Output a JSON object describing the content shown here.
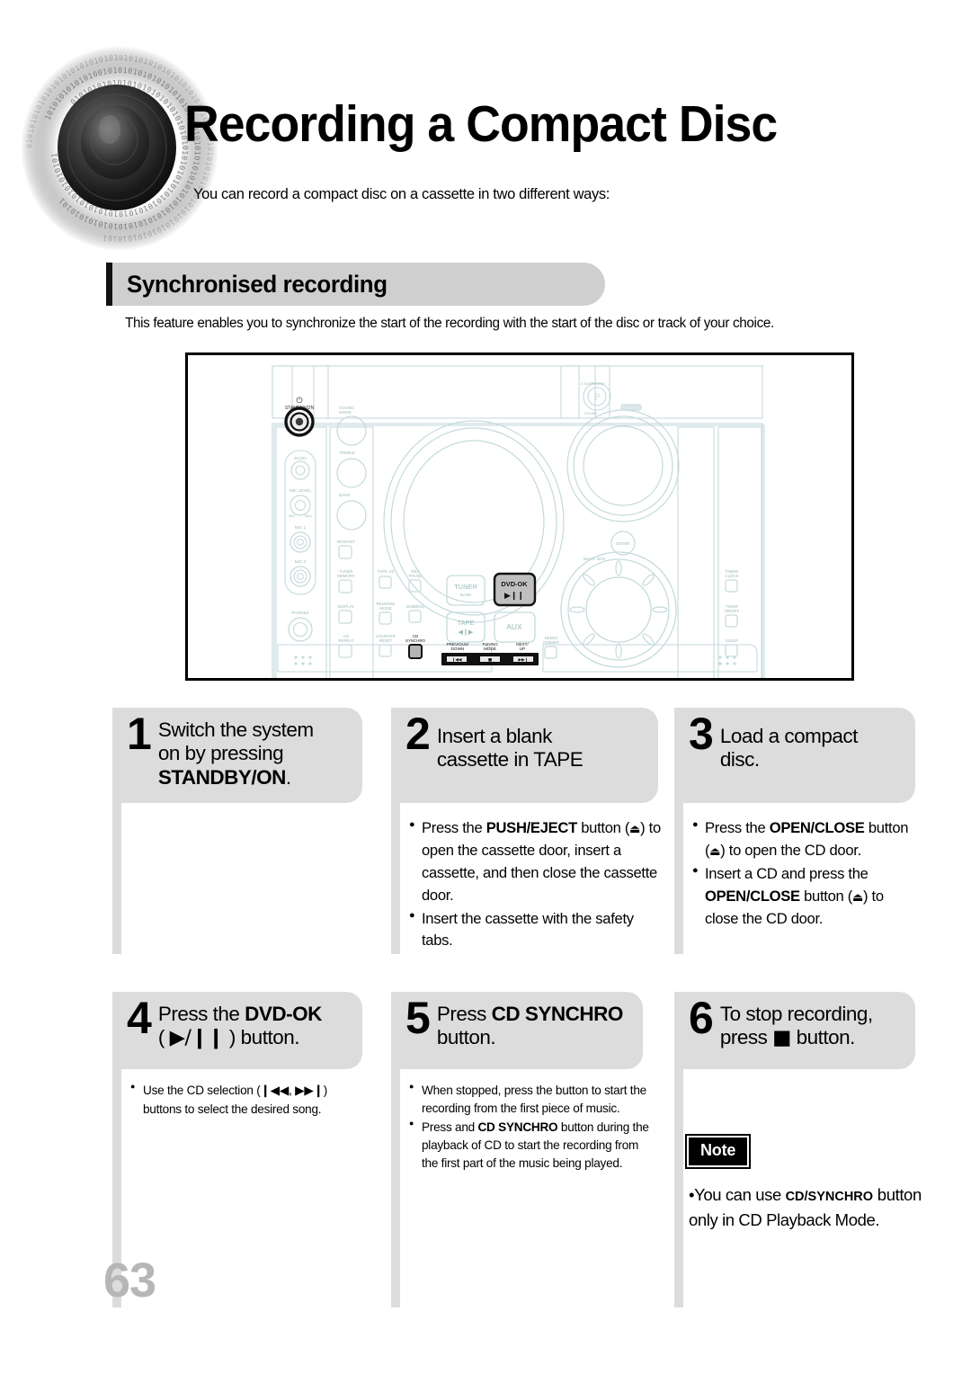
{
  "page": {
    "title": "Recording a Compact Disc",
    "intro": "You can record a compact disc on a cassette in two different ways:",
    "number": "63"
  },
  "section": {
    "heading": "Synchronised recording",
    "description": "This feature enables you to synchronize the start of the recording with the start of the disc or track of your choice."
  },
  "figure": {
    "caption": "",
    "panel_labels": {
      "standby": "STANDBY/ON",
      "sound_mode": "SOUND MODE",
      "treble": "TREBLE",
      "bass": "BASS",
      "echo": "ECHO",
      "mic_level": "MIC LEVEL",
      "mic1": "MIC 1",
      "mic2": "MIC 2",
      "phones": "PHONES",
      "mo_host": "MO/HOST",
      "tuner_memory": "TUNER MEMORY",
      "display": "DISPLAY",
      "cd_repeat": "CD REPEAT",
      "tape_12": "TAPE 1/2",
      "reverse_mode": "REVERSE MODE",
      "counter_reset": "COUNTER RESET",
      "rec_pause": "REC/PAUSE",
      "dubbing": "DUBBING",
      "cd_synchro": "CD SYNCHRO",
      "tuner_band": "TUNER/BAND",
      "dvd_ok": "DVD-OK",
      "tape": "TAPE",
      "aux": "AUX",
      "previous_down": "PREVIOUS/DOWN",
      "tuning_mode": "TUNING MODE",
      "next_up": "NEXT/UP",
      "demo_dimmer": "DEMO/DIMMER",
      "multi_jog": "MULTI JOG",
      "enter": "ENTER",
      "timer_clock": "TIMER/CLOCK",
      "timer_onoff": "TIMER ON/OFF",
      "sleep": "SLEEP",
      "surround": "SURROUND"
    }
  },
  "steps": [
    {
      "number": "1",
      "heading_plain_1": "Switch the system",
      "heading_plain_2": "on by pressing ",
      "heading_bold": "STANDBY/ON",
      "heading_tail": ".",
      "bullets": []
    },
    {
      "number": "2",
      "heading_plain_1": "Insert a blank",
      "heading_plain_2": "cassette in TAPE",
      "bullets": [
        "Press the PUSH/EJECT button ( ⏏ ) to open the cassette door, insert a cassette, and then close the cassette door.",
        "Insert the cassette with the safety tabs."
      ]
    },
    {
      "number": "3",
      "heading_plain_1": "Load a compact",
      "heading_plain_2": "disc.",
      "bullets": [
        "Press the OPEN/CLOSE button ( ⏏ ) to open the CD door.",
        "Insert a CD and press the OPEN/CLOSE button ( ⏏ ) to close the CD door."
      ]
    },
    {
      "number": "4",
      "heading_plain_1": "Press the DVD-OK",
      "heading_plain_2": "( ▶/▐▐ ) button.",
      "bullets": [
        "Use the CD selection ( ⏮ , ⏭ ) buttons to select the desired song."
      ]
    },
    {
      "number": "5",
      "heading_plain_1": "Press CD SYNCHRO",
      "heading_plain_2": "button.",
      "bullets": [
        "When stopped, press the button to start the recording from the first piece of music.",
        "Press and  CD  SYNCHRO button during the playback of CD to start the recording from the first part of the music being played."
      ]
    },
    {
      "number": "6",
      "heading_plain_1": "To stop recording,",
      "heading_plain_2": "press ■ button.",
      "bullets": []
    }
  ],
  "step_text": {
    "s1_l1": "Switch the system",
    "s1_l2a": "on by pressing",
    "s1_l3b": "STANDBY/ON",
    "s1_l3t": ".",
    "s2_l1": "Insert a blank",
    "s2_l2": "cassette in TAPE",
    "s2_b1_a": "Press the ",
    "s2_b1_b": "PUSH/EJECT",
    "s2_b1_c": " button (",
    "s2_b1_d": ") to open the cassette door, insert a cassette, and then close the cassette door.",
    "s2_b2": "Insert the cassette with the safety tabs.",
    "s3_l1": "Load a compact",
    "s3_l2": "disc.",
    "s3_b1_a": "Press the ",
    "s3_b1_b": "OPEN/CLOSE",
    "s3_b1_c": " button (",
    "s3_b1_d": ") to open the CD door.",
    "s3_b2_a": "Insert a CD and press the ",
    "s3_b2_b": "OPEN/CLOSE",
    "s3_b2_c": " button (",
    "s3_b2_d": ") to close the CD door.",
    "s4_l1a": "Press the ",
    "s4_l1b": "DVD-OK",
    "s4_l2": ") button.",
    "s4_b1_a": "Use the CD selection (",
    "s4_b1_b": ") buttons to select the desired song.",
    "s5_l1a": "Press ",
    "s5_l1b": "CD SYNCHRO",
    "s5_l2": "button.",
    "s5_b1": "When stopped, press the button to start the recording from the first piece of music.",
    "s5_b2_a": "Press and  ",
    "s5_b2_b": "CD  SYNCHRO",
    "s5_b2_c": " button during the playback of CD to start the recording from the first part of the music being played.",
    "s6_l1": "To stop recording,",
    "s6_l2a": "press ",
    "s6_l2b": " button."
  },
  "note": {
    "label": "Note",
    "text_a": "You can use ",
    "text_b": "CD/SYNCHRO",
    "text_c": " button only in CD Playback Mode."
  },
  "colors": {
    "header_gray": "#cfcfcf",
    "card_gray": "#dcdcdc",
    "page_number_gray": "#b6b6b6",
    "panel_line": "#cfe0e0",
    "ink": "#000000"
  }
}
